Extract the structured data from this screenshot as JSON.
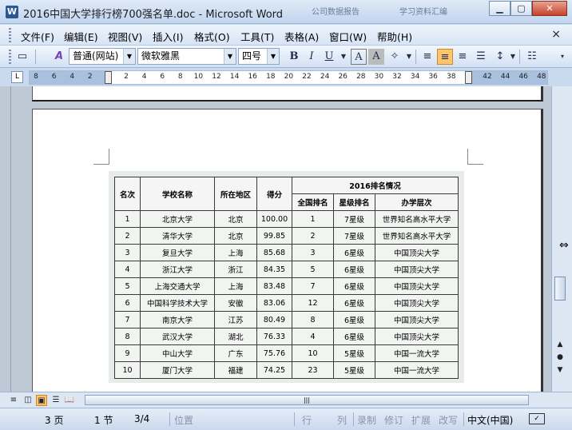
{
  "window": {
    "title": "2016中国大学排行榜700强名单.doc - Microsoft Word",
    "app_icon": "W",
    "ghost_tabs": [
      "公司数据报告",
      "学习资料汇编"
    ],
    "buttons": {
      "minimize": "▁",
      "maximize": "▢",
      "close": "✕"
    }
  },
  "menubar": {
    "items": [
      "文件(F)",
      "编辑(E)",
      "视图(V)",
      "插入(I)",
      "格式(O)",
      "工具(T)",
      "表格(A)",
      "窗口(W)",
      "帮助(H)"
    ],
    "doc_close": "×"
  },
  "toolbar": {
    "style_value": "普通(网站)",
    "font_value": "微软雅黑",
    "size_value": "四号",
    "bold": "B",
    "italic": "I",
    "underline": "U",
    "align_center_active": true
  },
  "ruler": {
    "numbers": [
      "8",
      "6",
      "4",
      "2",
      "",
      "2",
      "4",
      "6",
      "8",
      "10",
      "12",
      "14",
      "16",
      "18",
      "20",
      "22",
      "24",
      "26",
      "28",
      "30",
      "32",
      "34",
      "36",
      "38",
      "",
      "42",
      "44",
      "46",
      "48"
    ]
  },
  "table": {
    "header": {
      "rank": "名次",
      "school": "学校名称",
      "region": "所在地区",
      "score": "得分",
      "group": "2016排名情况",
      "national": "全国排名",
      "star": "星级排名",
      "level": "办学层次"
    },
    "rows": [
      [
        "1",
        "北京大学",
        "北京",
        "100.00",
        "1",
        "7星级",
        "世界知名高水平大学"
      ],
      [
        "2",
        "清华大学",
        "北京",
        "99.85",
        "2",
        "7星级",
        "世界知名高水平大学"
      ],
      [
        "3",
        "复旦大学",
        "上海",
        "85.68",
        "3",
        "6星级",
        "中国顶尖大学"
      ],
      [
        "4",
        "浙江大学",
        "浙江",
        "84.35",
        "5",
        "6星级",
        "中国顶尖大学"
      ],
      [
        "5",
        "上海交通大学",
        "上海",
        "83.48",
        "7",
        "6星级",
        "中国顶尖大学"
      ],
      [
        "6",
        "中国科学技术大学",
        "安徽",
        "83.06",
        "12",
        "6星级",
        "中国顶尖大学"
      ],
      [
        "7",
        "南京大学",
        "江苏",
        "80.49",
        "8",
        "6星级",
        "中国顶尖大学"
      ],
      [
        "8",
        "武汉大学",
        "湖北",
        "76.33",
        "4",
        "6星级",
        "中国顶尖大学"
      ],
      [
        "9",
        "中山大学",
        "广东",
        "75.76",
        "10",
        "5星级",
        "中国一流大学"
      ],
      [
        "10",
        "厦门大学",
        "福建",
        "74.25",
        "23",
        "5星级",
        "中国一流大学"
      ]
    ]
  },
  "status": {
    "page": "3 页",
    "section": "1 节",
    "pages": "3/4",
    "position": "位置",
    "line": "行",
    "column": "列",
    "rec": "录制",
    "trk": "修订",
    "ext": "扩展",
    "ovr": "改写",
    "lang": "中文(中国)"
  },
  "colors": {
    "accent_active": "#ffc56b",
    "chrome": "#c9d9ee"
  }
}
